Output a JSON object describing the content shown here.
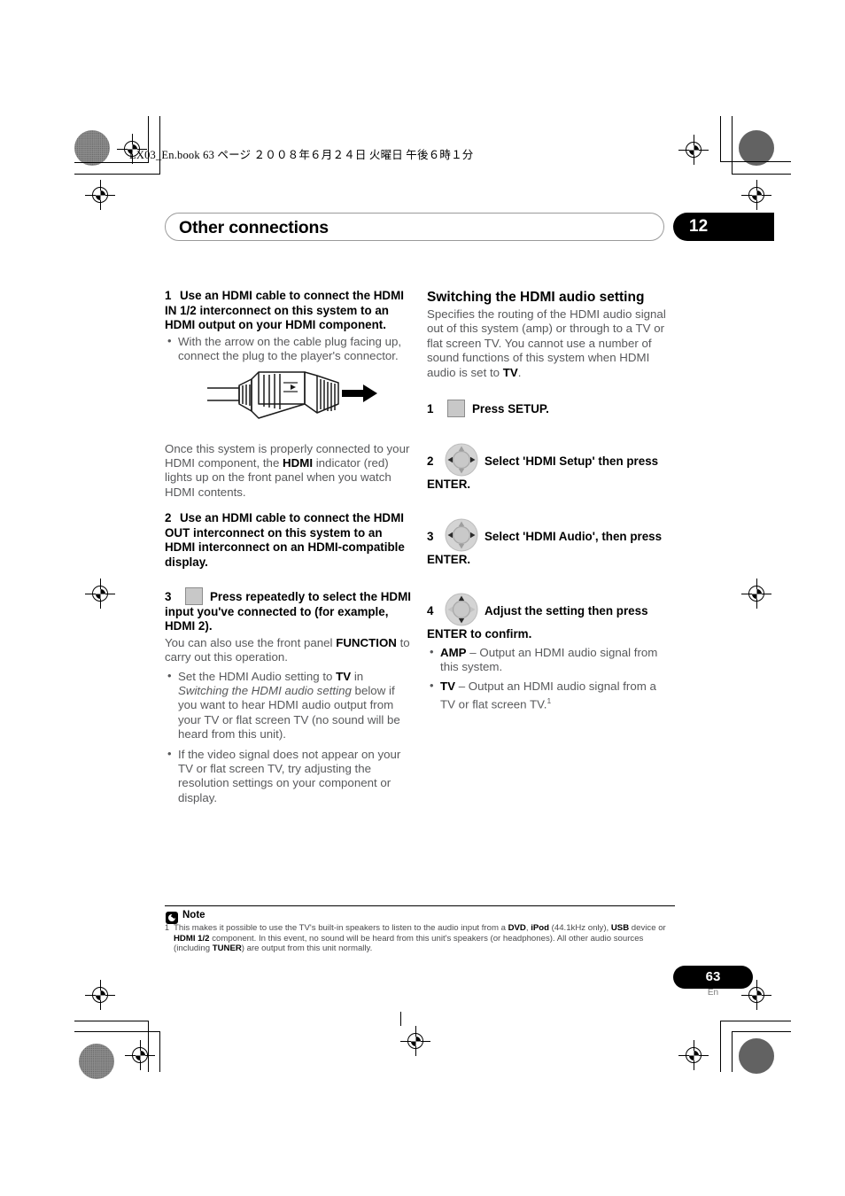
{
  "print_header": {
    "text": "LX03_En.book   63 ページ   ２００８年６月２４日   火曜日   午後６時１分"
  },
  "chapter": {
    "title": "Other connections",
    "number": "12"
  },
  "left_column": {
    "step1": {
      "num": "1",
      "text": "Use an HDMI cable to connect the HDMI IN 1/2 interconnect on this system to an HDMI output on your HDMI component.",
      "bullets": [
        "With the arrow on the cable plug facing up, connect the plug to the player's connector."
      ]
    },
    "figure_caption": "hdmi-cable-plug-illustration",
    "para_after_figure": {
      "part1": "Once this system is properly connected to your HDMI component, the ",
      "bold1": "HDMI",
      "part2": " indicator (red) lights up on the front panel when you watch HDMI contents."
    },
    "step2": {
      "num": "2",
      "text": "Use an HDMI cable to connect the HDMI OUT interconnect on this system to an HDMI interconnect on an HDMI-compatible display."
    },
    "step3": {
      "num": "3",
      "icon": "square-button-icon",
      "text": "Press repeatedly to select the HDMI input you've connected to (for example, HDMI 2).",
      "body_part1": "You can also use the front panel ",
      "body_bold": "FUNCTION",
      "body_part2": " to carry out this operation.",
      "bullets": [
        {
          "p1": "Set the HDMI Audio setting to ",
          "b1": "TV",
          "p2": " in ",
          "i1": "Switching the HDMI audio setting",
          "p3": " below if you want to hear HDMI audio output from your TV or flat screen TV (no sound will be heard from this unit)."
        },
        {
          "p1": "If the video signal does not appear on your TV or flat screen TV, try adjusting the resolution settings on your component or display.",
          "b1": "",
          "p2": "",
          "i1": "",
          "p3": ""
        }
      ]
    }
  },
  "right_column": {
    "heading": "Switching the HDMI audio setting",
    "intro_p1": "Specifies the routing of the HDMI audio signal out of this system (amp) or through to a TV or flat screen TV. You cannot use a number of sound functions of this system when HDMI audio is set to ",
    "intro_b1": "TV",
    "intro_p2": ".",
    "step1": {
      "num": "1",
      "icon": "square-button-icon",
      "text": "Press SETUP."
    },
    "step2": {
      "num": "2",
      "icon": "dpad-icon",
      "text": "Select 'HDMI Setup' then press ENTER."
    },
    "step3": {
      "num": "3",
      "icon": "dpad-icon",
      "text": "Select 'HDMI Audio', then press ENTER."
    },
    "step4": {
      "num": "4",
      "icon": "dpad-updown-icon",
      "text": "Adjust the setting then press ENTER to confirm.",
      "options": [
        {
          "label": "AMP",
          "desc": " – Output an HDMI audio signal from this system.",
          "sup": ""
        },
        {
          "label": "TV",
          "desc": " – Output an HDMI audio signal from a TV or flat screen TV.",
          "sup": "1"
        }
      ]
    }
  },
  "footnote": {
    "label": "Note",
    "number": "1",
    "p1": "This makes it possible to use the TV's built-in speakers to listen to the audio input from a ",
    "b1": "DVD",
    "p2": ", ",
    "b2": "iPod",
    "p3": " (44.1kHz only), ",
    "b3": "USB",
    "p4": " device or ",
    "b4": "HDMI 1/2",
    "p5": " component. In this event, no sound will be heard from this unit's speakers (or headphones). All other audio sources (including ",
    "b5": "TUNER",
    "p6": ") are output from this unit normally."
  },
  "page_footer": {
    "number": "63",
    "language": "En"
  },
  "colors": {
    "body_text": "#58595b",
    "heading_text": "#000000",
    "accent_black": "#000000",
    "button_gray": "#c8c8c8"
  }
}
